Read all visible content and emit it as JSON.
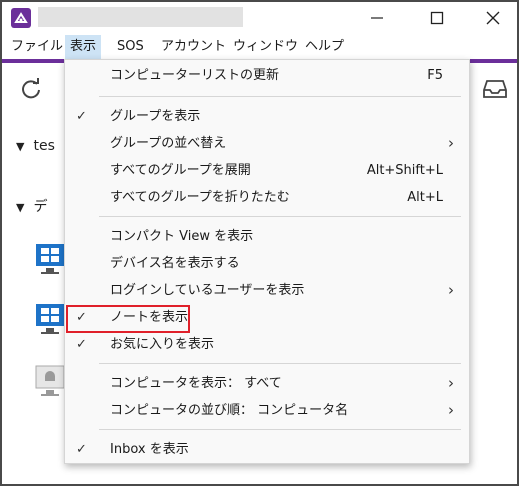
{
  "titlebar": {
    "minimize": "minimize",
    "maximize": "maximize",
    "close": "close"
  },
  "menubar": {
    "items": [
      {
        "label": "ファイル"
      },
      {
        "label": "表示"
      },
      {
        "label": "SOS"
      },
      {
        "label": "アカウント"
      },
      {
        "label": "ウィンドウ"
      },
      {
        "label": "ヘルプ"
      }
    ]
  },
  "background": {
    "group1": "tes",
    "group2": "デ"
  },
  "view_menu": {
    "items": [
      {
        "label": "コンピューターリストの更新",
        "shortcut": "F5"
      },
      {
        "label": "グループを表示",
        "check": "✓"
      },
      {
        "label": "グループの並べ替え",
        "submenu": "›"
      },
      {
        "label": "すべてのグループを展開",
        "shortcut": "Alt+Shift+L"
      },
      {
        "label": "すべてのグループを折りたたむ",
        "shortcut": "Alt+L"
      },
      {
        "label": "コンパクト View を表示"
      },
      {
        "label": "デバイス名を表示する"
      },
      {
        "label": "ログインしているユーザーを表示",
        "submenu": "›"
      },
      {
        "label": "ノートを表示",
        "check": "✓"
      },
      {
        "label": "お気に入りを表示",
        "check": "✓"
      },
      {
        "label": "コンピュータを表示： すべて",
        "submenu": "›"
      },
      {
        "label": "コンピュータの並び順： コンピュータ名",
        "submenu": "›"
      },
      {
        "label": "Inbox を表示",
        "check": "✓"
      }
    ]
  },
  "colors": {
    "accent": "#6b2f9a",
    "menu_highlight": "#cde3f5",
    "annotation_box": "#e0202a",
    "windows_blue": "#1e73c8"
  },
  "icons": [
    "app-logo-icon",
    "minimize-icon",
    "maximize-icon",
    "close-icon",
    "refresh-icon",
    "inbox-icon",
    "windows-computer-icon",
    "android-computer-icon",
    "checkmark-icon",
    "chevron-right-icon"
  ]
}
